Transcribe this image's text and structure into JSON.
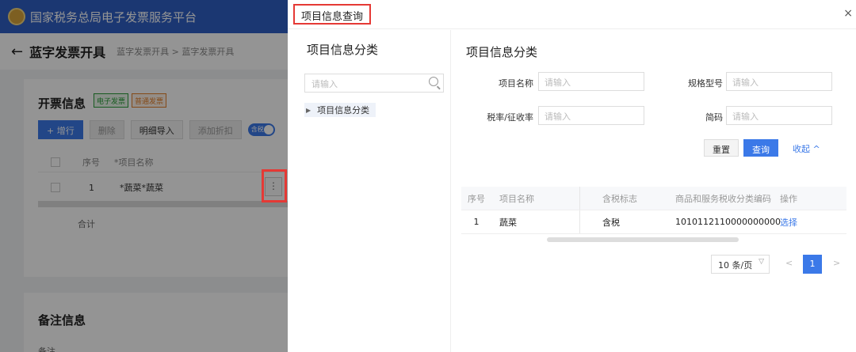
{
  "background": {
    "app_title": "国家税务总局电子发票服务平台",
    "page_title": "蓝字发票开具",
    "breadcrumb": "蓝字发票开具 > 蓝字发票开具",
    "section_invoice": "开票信息",
    "tag_electronic": "电子发票",
    "tag_ordinary": "普通发票",
    "buttons": [
      "+ 增行",
      "删除",
      "明细导入",
      "添加折扣"
    ],
    "toggle_label": "含税",
    "table_headers": [
      "序号",
      "*项目名称"
    ],
    "row": {
      "index": "1",
      "name": "*蔬菜*蔬菜"
    },
    "total_label": "合计",
    "section_remark": "备注信息",
    "remark_label": "备注"
  },
  "modal": {
    "title": "项目信息查询",
    "close_icon": "×",
    "left": {
      "title": "项目信息分类",
      "search_placeholder": "请输入",
      "tree_node": "项目信息分类"
    },
    "right": {
      "title": "项目信息分类",
      "fields": {
        "name_label": "项目名称",
        "name_placeholder": "请输入",
        "spec_label": "规格型号",
        "spec_placeholder": "请输入",
        "rate_label": "税率/征收率",
        "rate_placeholder": "请输入",
        "short_label": "简码",
        "short_placeholder": "请输入"
      },
      "actions": {
        "reset": "重置",
        "query": "查询",
        "collapse": "收起 ^"
      },
      "table": {
        "headers": [
          "序号",
          "项目名称",
          "含税标志",
          "商品和服务税收分类编码",
          "操作"
        ],
        "rows": [
          {
            "index": "1",
            "name": "蔬菜",
            "tax_flag": "含税",
            "code": "1010112110000000000",
            "action": "选择"
          }
        ]
      },
      "pagination": {
        "page_size": "10 条/页",
        "prev": "<",
        "current": "1",
        "next": ">"
      }
    }
  }
}
